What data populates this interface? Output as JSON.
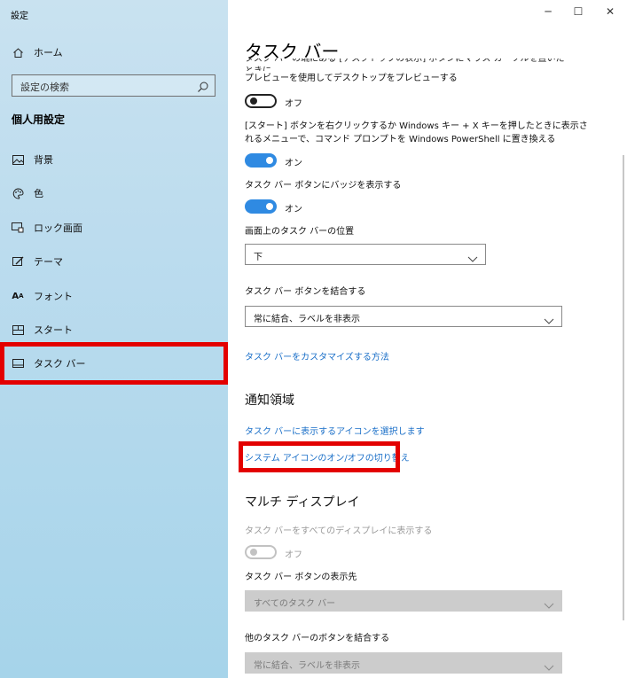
{
  "window": {
    "title": "設定",
    "minimize_glyph": "─",
    "maximize_glyph": "☐",
    "close_glyph": "✕"
  },
  "sidebar": {
    "home_label": "ホーム",
    "search_placeholder": "設定の検索",
    "section_title": "個人用設定",
    "items": [
      {
        "label": "背景",
        "icon": "image-icon"
      },
      {
        "label": "色",
        "icon": "palette-icon"
      },
      {
        "label": "ロック画面",
        "icon": "lock-screen-icon"
      },
      {
        "label": "テーマ",
        "icon": "theme-icon"
      },
      {
        "label": "フォント",
        "icon": "font-icon"
      },
      {
        "label": "スタート",
        "icon": "start-icon"
      },
      {
        "label": "タスク バー",
        "icon": "taskbar-icon",
        "selected": true
      }
    ],
    "highlight_color": "#e30000"
  },
  "main": {
    "title": "タスク バー",
    "cut_text": "タスク バーの端にある [デスクトップの表示] ボタンにマウス カーソルを置いたときに、",
    "peek": {
      "desc": "プレビューを使用してデスクトップをプレビューする",
      "state": "オフ"
    },
    "powershell": {
      "desc_line1": "[スタート] ボタンを右クリックするか Windows キー + X キーを押したときに表示さ",
      "desc_line2": "れるメニューで、コマンド プロンプトを Windows PowerShell に置き換える",
      "state": "オン"
    },
    "badges": {
      "desc": "タスク バー ボタンにバッジを表示する",
      "state": "オン"
    },
    "location": {
      "label": "画面上のタスク バーの位置",
      "value": "下"
    },
    "combine": {
      "label": "タスク バー ボタンを結合する",
      "value": "常に結合、ラベルを非表示"
    },
    "customize_link": "タスク バーをカスタマイズする方法",
    "notification": {
      "heading": "通知領域",
      "link_select_icons": "タスク バーに表示するアイコンを選択します",
      "link_system_icons": "システム アイコンのオン/オフの切り替え"
    },
    "multi_display": {
      "heading": "マルチ ディスプレイ",
      "show_all_label": "タスク バーをすべてのディスプレイに表示する",
      "show_all_state": "オフ",
      "buttons_on_label": "タスク バー ボタンの表示先",
      "buttons_on_value": "すべてのタスク バー",
      "combine_other_label": "他のタスク バーのボタンを結合する",
      "combine_other_value": "常に結合、ラベルを非表示"
    },
    "accent_color": "#2f8ae2",
    "link_color": "#1a6fc8"
  }
}
